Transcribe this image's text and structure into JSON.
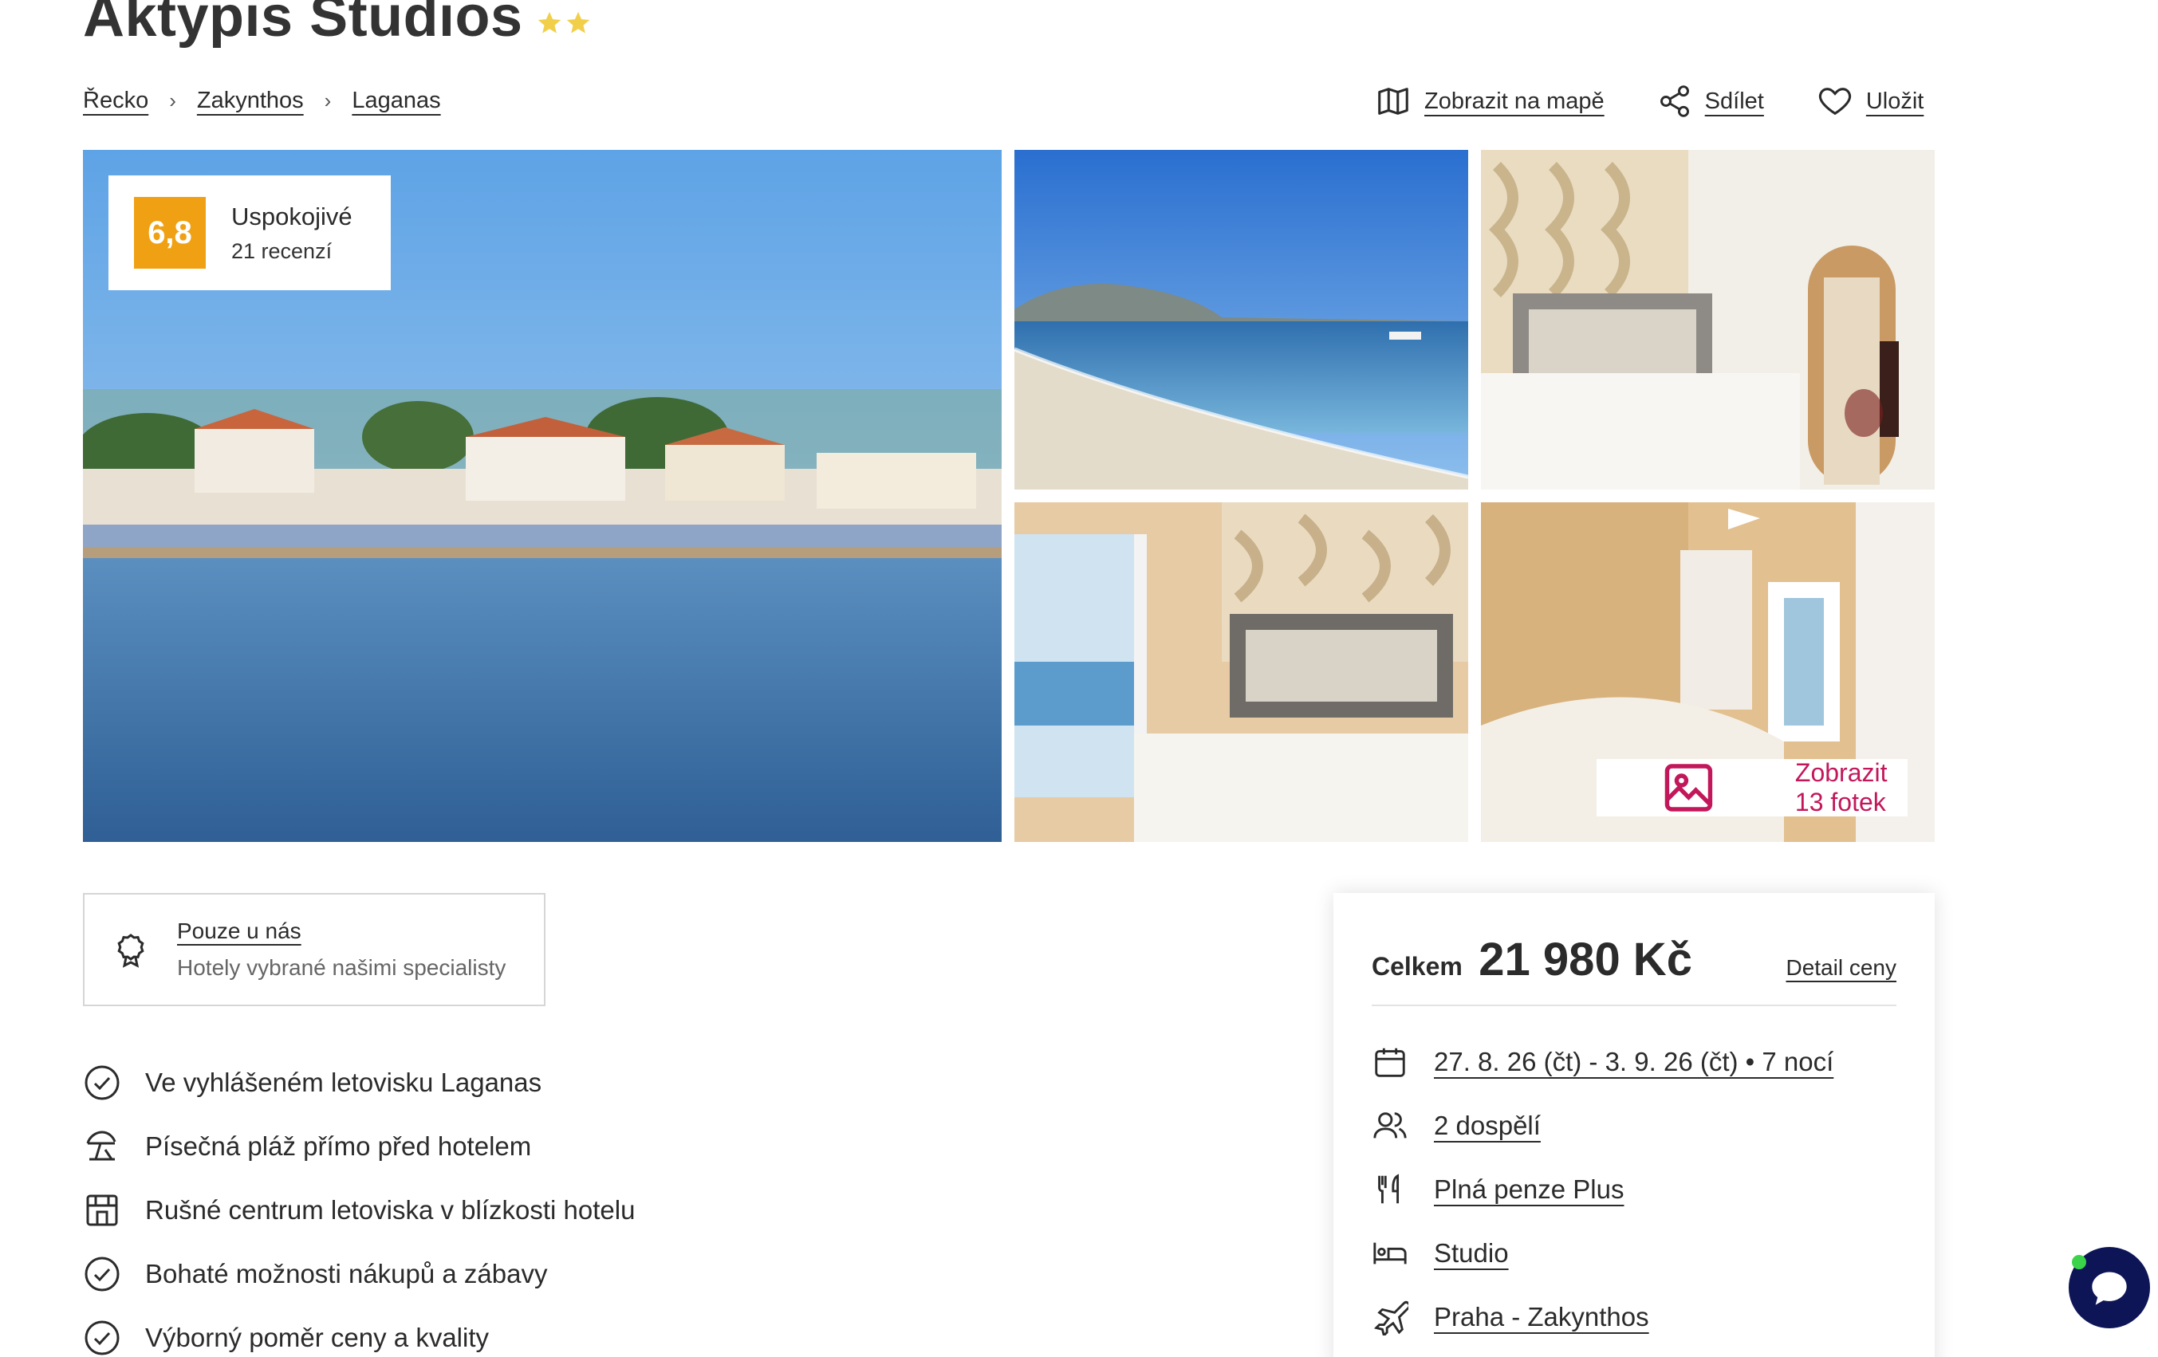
{
  "hotel": {
    "name": "Aktypis Studios",
    "stars": 2
  },
  "breadcrumb": [
    "Řecko",
    "Zakynthos",
    "Laganas"
  ],
  "actions": {
    "map": "Zobrazit na mapě",
    "share": "Sdílet",
    "save": "Uložit"
  },
  "rating": {
    "score": "6,8",
    "label": "Uspokojivé",
    "reviews": "21 recenzí"
  },
  "gallery": {
    "show_photos": "Zobrazit 13 fotek"
  },
  "exclusive": {
    "title": "Pouze u nás",
    "subtitle": "Hotely vybrané našimi specialisty"
  },
  "features": [
    {
      "icon": "check-circle-icon",
      "text": "Ve vyhlášeném letovisku Laganas"
    },
    {
      "icon": "beach-umbrella-icon",
      "text": "Písečná pláž přímo před hotelem"
    },
    {
      "icon": "storefront-icon",
      "text": "Rušné centrum letoviska v blízkosti hotelu"
    },
    {
      "icon": "check-circle-icon",
      "text": "Bohaté možnosti nákupů a zábavy"
    },
    {
      "icon": "check-circle-icon",
      "text": "Výborný poměr ceny a kvality"
    }
  ],
  "price": {
    "label": "Celkem",
    "amount": "21 980 Kč",
    "detail": "Detail ceny"
  },
  "trip": {
    "dates": "27. 8. 26 (čt) - 3. 9. 26 (čt) • 7 nocí",
    "travelers": "2 dospělí",
    "board": "Plná penze Plus",
    "room": "Studio",
    "flight": "Praha - Zakynthos"
  },
  "colors": {
    "rating_badge": "#f0a113",
    "accent_pink": "#c2185b",
    "chat_bg": "#0d1557",
    "star": "#f2cf4a"
  }
}
